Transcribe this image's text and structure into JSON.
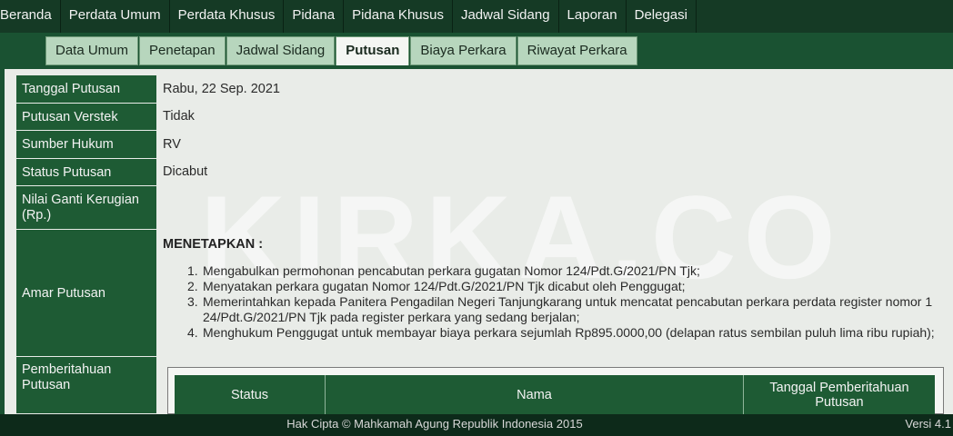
{
  "topnav": {
    "items": [
      "Beranda",
      "Perdata Umum",
      "Perdata Khusus",
      "Pidana",
      "Pidana Khusus",
      "Jadwal Sidang",
      "Laporan",
      "Delegasi"
    ]
  },
  "subtabs": {
    "items": [
      "Data Umum",
      "Penetapan",
      "Jadwal Sidang",
      "Putusan",
      "Biaya Perkara",
      "Riwayat Perkara"
    ],
    "active": "Putusan"
  },
  "details": {
    "tanggal_putusan": {
      "label": "Tanggal Putusan",
      "value": "Rabu, 22 Sep. 2021"
    },
    "putusan_verstek": {
      "label": "Putusan Verstek",
      "value": "Tidak"
    },
    "sumber_hukum": {
      "label": "Sumber Hukum",
      "value": "RV"
    },
    "status_putusan": {
      "label": "Status Putusan",
      "value": "Dicabut"
    },
    "nilai_ganti": {
      "label": "Nilai Ganti Kerugian (Rp.)",
      "value": ""
    },
    "amar_putusan": {
      "label": "Amar Putusan"
    },
    "pemberitahuan": {
      "label": "Pemberitahuan Putusan"
    }
  },
  "amar": {
    "heading": "MENETAPKAN :",
    "items": [
      "Mengabulkan permohonan pencabutan perkara gugatan Nomor 124/Pdt.G/2021/PN Tjk;",
      "Menyatakan perkara gugatan Nomor 124/Pdt.G/2021/PN Tjk dicabut oleh Penggugat;",
      "Memerintahkan kepada Panitera Pengadilan Negeri Tanjungkarang untuk mencatat pencabutan perkara perdata register nomor 1 24/Pdt.G/2021/PN Tjk pada register perkara yang sedang berjalan;",
      "Menghukum Penggugat untuk membayar biaya perkara sejumlah Rp895.0000,00 (delapan ratus sembilan puluh lima ribu rupiah);"
    ]
  },
  "notification_table": {
    "headers": [
      "Status",
      "Nama",
      "Tanggal Pemberitahuan Putusan"
    ]
  },
  "watermark": "KIRKA.CO",
  "footer": {
    "copyright": "Hak Cipta © Mahkamah Agung Republik Indonesia 2015",
    "version": "Versi 4.1"
  },
  "colors": {
    "nav_bg": "#153a25",
    "label_bg": "#1e5b34",
    "tab_bg": "#b7d6bd",
    "page_bg": "#e9ece8"
  }
}
